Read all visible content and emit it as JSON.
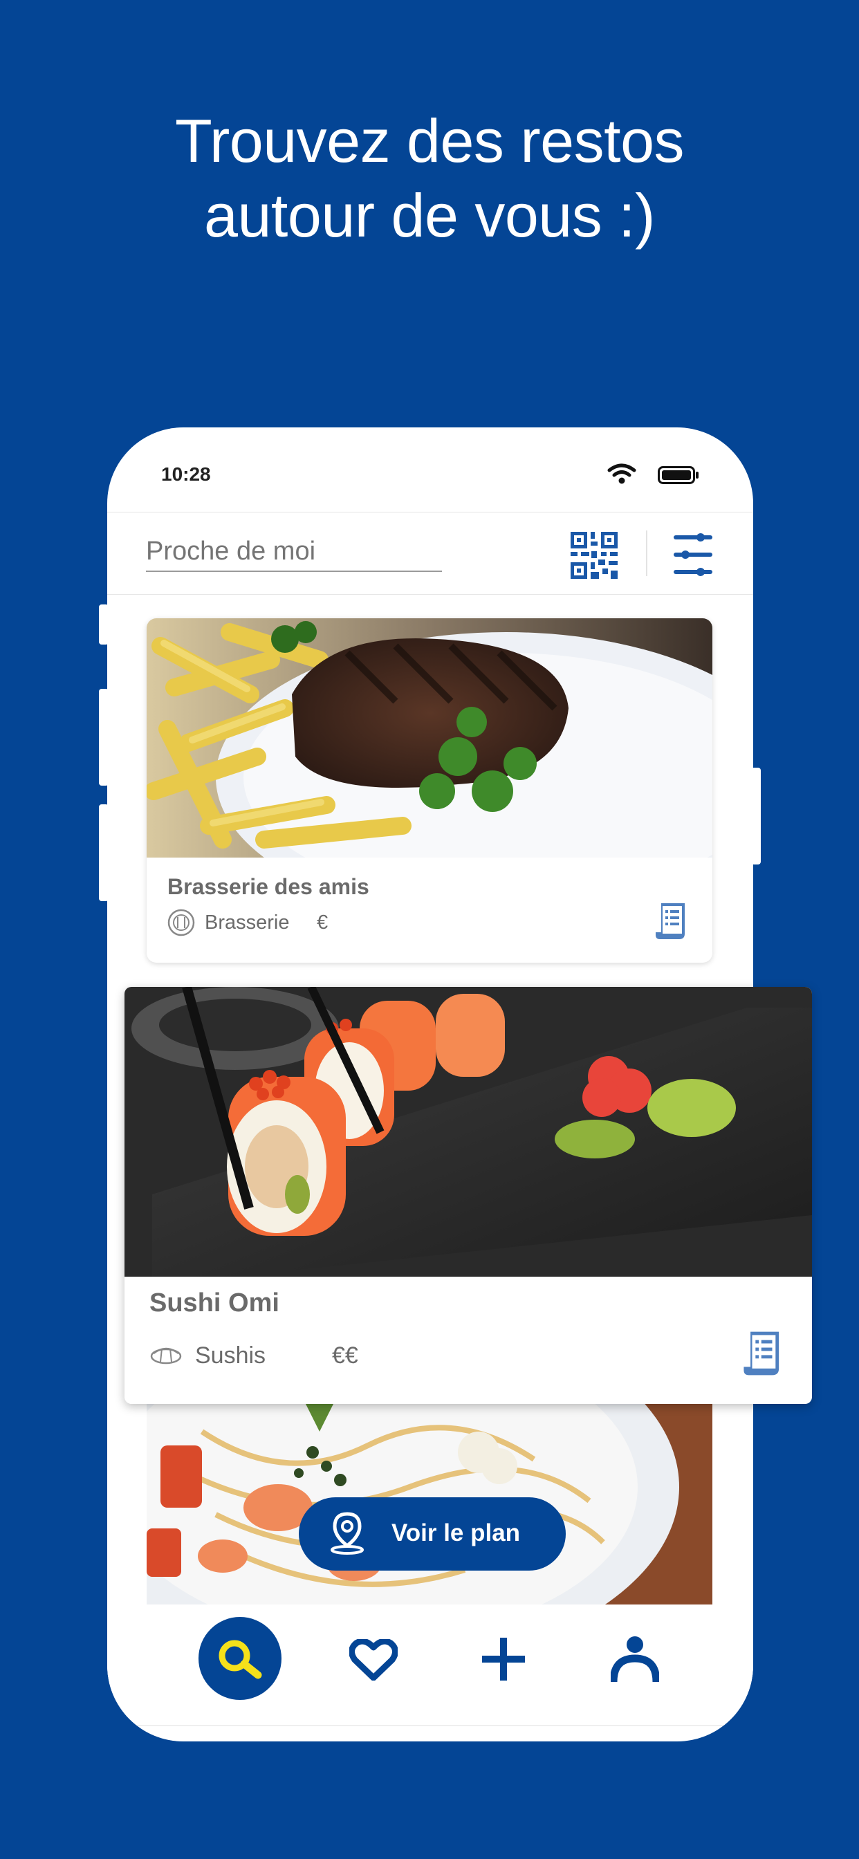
{
  "headline": {
    "line1": "Trouvez des restos",
    "line2": "autour de vous :)"
  },
  "colors": {
    "brand_blue": "#044595",
    "accent_yellow": "#F5E11A",
    "icon_blue": "#4F80C0"
  },
  "status_bar": {
    "time": "10:28",
    "icons": [
      "wifi-icon",
      "battery-icon"
    ]
  },
  "search": {
    "placeholder": "Proche de moi",
    "actions": [
      "qr-code-icon",
      "filter-sliders-icon"
    ]
  },
  "restaurants": [
    {
      "name": "Brasserie des amis",
      "category": "Brasserie",
      "category_icon": "plate-cutlery-icon",
      "price": "€",
      "menu_icon": "menu-document-icon"
    },
    {
      "name": "Sushi Omi",
      "category": "Sushis",
      "category_icon": "sushi-icon",
      "price": "€€",
      "menu_icon": "menu-document-icon"
    },
    {
      "name": "",
      "category": "",
      "price": ""
    }
  ],
  "map_button": {
    "label": "Voir le plan",
    "icon": "map-pin-icon"
  },
  "tab_bar": {
    "items": [
      "search-icon",
      "heart-icon",
      "plus-icon",
      "profile-icon"
    ],
    "active": "search-icon"
  }
}
